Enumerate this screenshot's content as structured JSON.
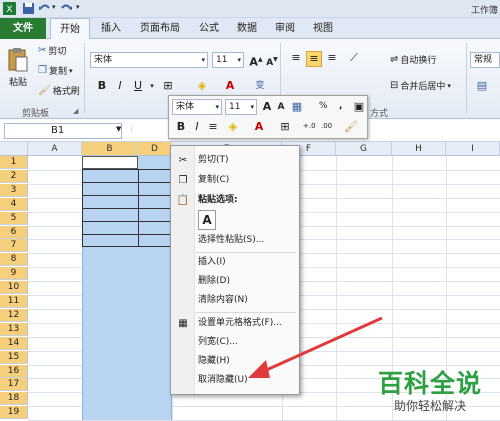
{
  "window": {
    "title": "工作簿"
  },
  "ribbon_tabs": [
    "文件",
    "开始",
    "插入",
    "页面布局",
    "公式",
    "数据",
    "审阅",
    "视图"
  ],
  "clipboard": {
    "paste": "粘贴",
    "cut": "剪切",
    "copy": "复制",
    "format_painter": "格式刷",
    "group": "剪贴板"
  },
  "font": {
    "name": "宋体",
    "size": "11"
  },
  "alignment": {
    "wrap": "自动换行",
    "merge": "合并后居中",
    "group_suffix": "方式"
  },
  "number": {
    "format": "常规"
  },
  "formula_bar": {
    "namebox": "B1",
    "fx": "fx"
  },
  "columns": [
    "A",
    "B",
    "D",
    "E",
    "F",
    "G",
    "H",
    "I"
  ],
  "rows": [
    "1",
    "2",
    "3",
    "4",
    "5",
    "6",
    "7",
    "8",
    "9",
    "10",
    "11",
    "12",
    "13",
    "14",
    "15",
    "16",
    "17",
    "18",
    "19"
  ],
  "mini_toolbar": {
    "font": "宋体",
    "size": "11",
    "percent": "%",
    "comma": ",",
    "dec_inc": "+.0",
    "dec_dec": ".00"
  },
  "context_menu": {
    "cut": "剪切(T)",
    "copy": "复制(C)",
    "paste_options": "粘贴选项:",
    "paste_special": "选择性粘贴(S)...",
    "insert": "插入(I)",
    "delete": "删除(D)",
    "clear": "清除内容(N)",
    "format_cells": "设置单元格格式(F)...",
    "col_width": "列宽(C)...",
    "hide": "隐藏(H)",
    "unhide": "取消隐藏(U)"
  },
  "watermark": {
    "big": "百科全说",
    "small": "助你轻松解决"
  },
  "colors": {
    "file_tab": "#2a7c32",
    "selection": "#b8d4f0",
    "header_sel": "#f5cf7b",
    "arrow": "#e03a3a",
    "watermark": "#2ea043"
  }
}
